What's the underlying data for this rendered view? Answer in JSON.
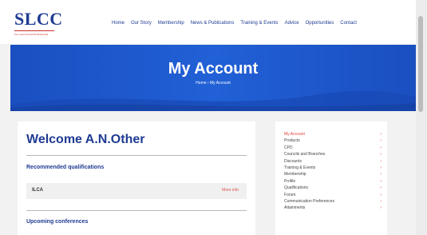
{
  "logo": {
    "text": "SLCC",
    "tagline": "For Local Council Professionals"
  },
  "nav": [
    "Home",
    "Our Story",
    "Membership",
    "News & Publications",
    "Training & Events",
    "Advice",
    "Opportunities",
    "Contact"
  ],
  "banner": {
    "title": "My Account",
    "breadcrumb": "Home › My Account"
  },
  "main": {
    "welcome": "Welcome A.N.Other",
    "recommended_title": "Recommended qualifications",
    "qualification": {
      "name": "ILCA",
      "link": "More info"
    },
    "conferences_title": "Upcoming conferences"
  },
  "side_menu": {
    "items": [
      "My Account",
      "Products",
      "CPD",
      "Councils and Branches",
      "Discounts",
      "Training & Events",
      "Membership",
      "Profile",
      "Qualifications",
      "Forum",
      "Communication Preferences",
      "Attainments"
    ],
    "active_index": 0,
    "arrow": "›"
  },
  "colors": {
    "brand_blue": "#1f3b93",
    "banner_blue": "#2160d6",
    "accent_red": "#e0403a"
  }
}
